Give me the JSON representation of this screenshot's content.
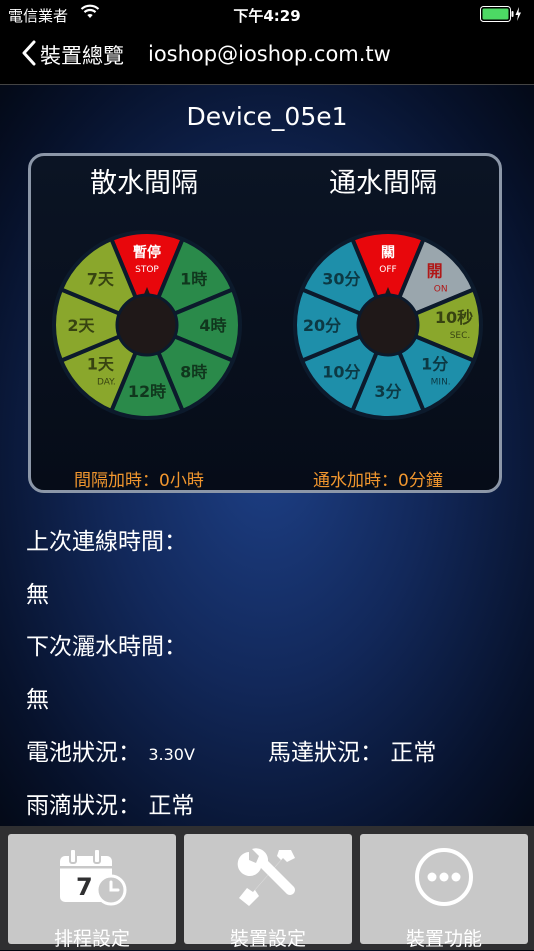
{
  "status_bar": {
    "carrier": "電信業者",
    "time": "下午4:29"
  },
  "nav": {
    "back_label": "裝置總覽",
    "title": "ioshop@ioshop.com.tw"
  },
  "device_name": "Device_05e1",
  "dials": {
    "sprinkle_interval": {
      "title": "散水間隔",
      "footer": "間隔加時：0小時",
      "segments": [
        {
          "label": "暫停",
          "sub": "STOP",
          "color": "#e8070c"
        },
        {
          "label": "1時",
          "sub": "",
          "color": "#2a8a4a"
        },
        {
          "label": "4時",
          "sub": "",
          "color": "#2a8a4a"
        },
        {
          "label": "8時",
          "sub": "",
          "color": "#2a8a4a"
        },
        {
          "label": "12時",
          "sub": "",
          "color": "#2a8a4a"
        },
        {
          "label": "1天",
          "sub": "DAY.",
          "color": "#8aa72c"
        },
        {
          "label": "2天",
          "sub": "",
          "color": "#8aa72c"
        },
        {
          "label": "7天",
          "sub": "",
          "color": "#8aa72c"
        }
      ]
    },
    "water_interval": {
      "title": "通水間隔",
      "footer": "通水加時：0分鐘",
      "segments": [
        {
          "label": "關",
          "sub": "OFF",
          "color": "#e8070c"
        },
        {
          "label": "開",
          "sub": "ON",
          "color": "#9aa6ad"
        },
        {
          "label": "10秒",
          "sub": "SEC.",
          "color": "#8aa72c"
        },
        {
          "label": "1分",
          "sub": "MIN.",
          "color": "#1e8faa"
        },
        {
          "label": "3分",
          "sub": "",
          "color": "#1e8faa"
        },
        {
          "label": "10分",
          "sub": "",
          "color": "#1e8faa"
        },
        {
          "label": "20分",
          "sub": "",
          "color": "#1e8faa"
        },
        {
          "label": "30分",
          "sub": "",
          "color": "#1e8faa"
        }
      ]
    }
  },
  "info": {
    "last_connect_label": "上次連線時間：",
    "last_connect_value": "無",
    "next_water_label": "下次灑水時間：",
    "next_water_value": "無",
    "battery_label": "電池狀況：",
    "battery_value": "3.30V",
    "motor_label": "馬達狀況：",
    "motor_value": "正常",
    "rain_label": "雨滴狀況：",
    "rain_value": "正常"
  },
  "toolbar": {
    "schedule_label": "排程設定",
    "device_settings_label": "裝置設定",
    "device_functions_label": "裝置功能",
    "schedule_icon_day": "7"
  },
  "colors": {
    "accent_orange": "#f0962e",
    "battery_green": "#4cd964",
    "dial_hub": "#1f1818"
  }
}
